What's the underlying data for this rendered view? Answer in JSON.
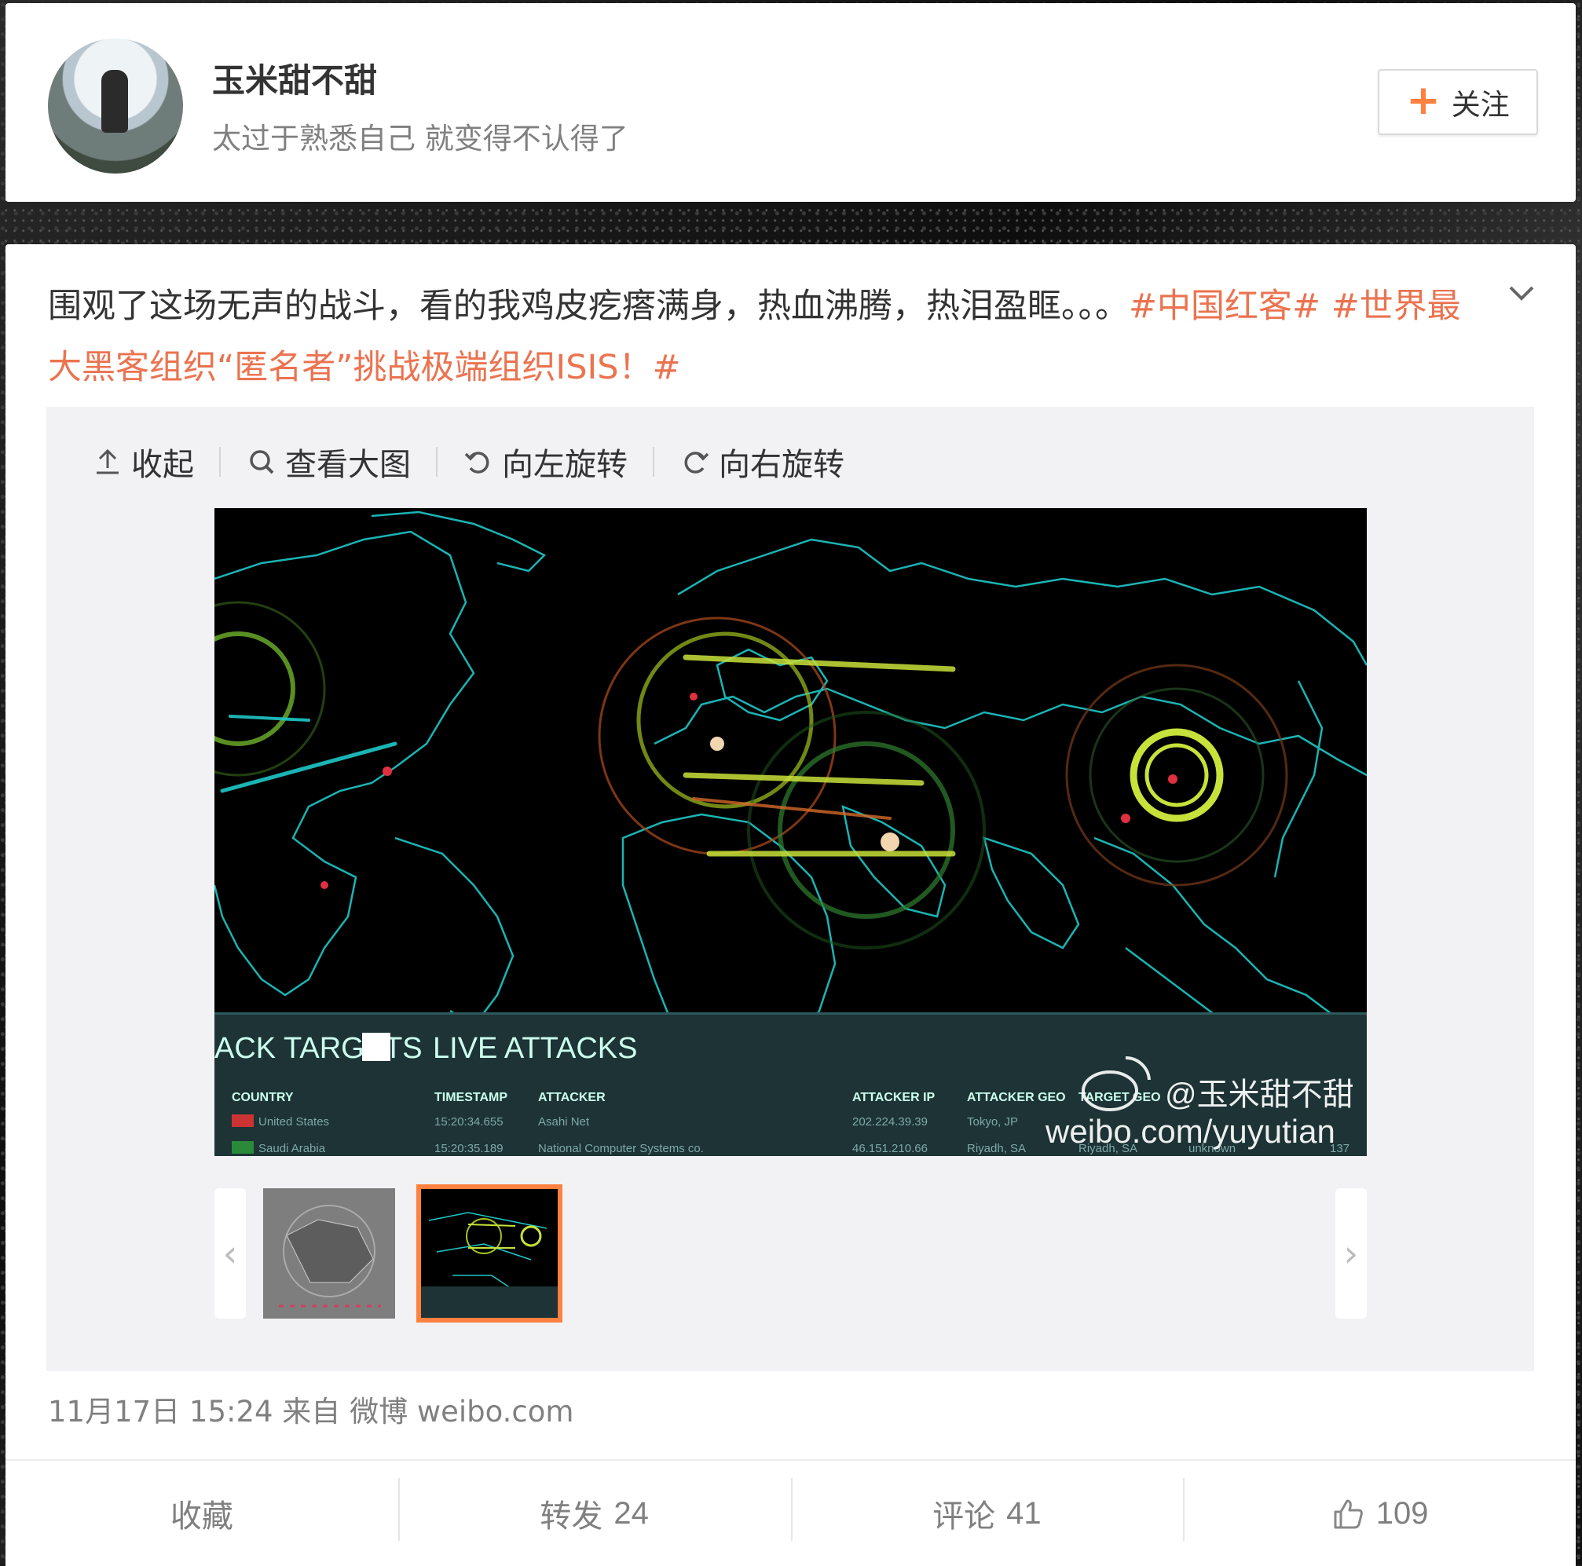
{
  "profile": {
    "username": "玉米甜不甜",
    "bio": "太过于熟悉自己 就变得不认得了",
    "follow_label": "关注"
  },
  "post": {
    "text": "围观了这场无声的战斗，看的我鸡皮疙瘩满身，热血沸腾，热泪盈眶。。。",
    "hashtags": [
      "#中国红客#",
      "#世界最大黑客组织“匿名者”挑战极端组织ISIS！#"
    ],
    "time": "11月17日 15:24 来自 微博 weibo.com",
    "toolbar": {
      "collapse": "收起",
      "view_large": "查看大图",
      "rotate_left": "向左旋转",
      "rotate_right": "向右旋转"
    },
    "image": {
      "panel_title_left": "ACK TARGETS",
      "panel_title_right": "LIVE ATTACKS",
      "col_country": "COUNTRY",
      "col_timestamp": "TIMESTAMP",
      "col_attacker": "ATTACKER",
      "col_attacker_ip": "ATTACKER IP",
      "col_attacker_geo": "ATTACKER GEO",
      "col_target_geo": "TARGET GEO",
      "row1_country": "United States",
      "row1_time": "15:20:34.655",
      "row1_attacker": "Asahi Net",
      "row1_ip": "202.224.39.39",
      "row1_geo": "Tokyo, JP",
      "row2_country": "Saudi Arabia",
      "row2_time": "15:20:35.189",
      "row2_attacker": "National Computer Systems co.",
      "row2_ip": "46.151.210.66",
      "row2_geo": "Riyadh, SA",
      "row2_target": "Riyadh, SA",
      "row2_extra": "unknown",
      "row2_port": "137",
      "watermark_user": "@玉米甜不甜",
      "watermark_url": "weibo.com/yuyutian"
    }
  },
  "actions": {
    "favorite": "收藏",
    "repost_label": "转发",
    "repost_count": "24",
    "comment_label": "评论",
    "comment_count": "41",
    "like_count": "109"
  },
  "colors": {
    "accent": "#ff8140",
    "hashtag": "#eb7350",
    "map_lines": "#1ec8c8"
  }
}
